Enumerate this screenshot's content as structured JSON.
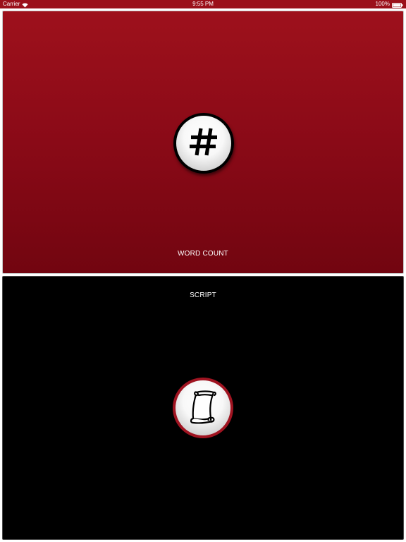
{
  "status_bar": {
    "carrier": "Carrier",
    "time": "9:55 PM",
    "battery": "100%",
    "background_color": "#9b101a"
  },
  "panels": [
    {
      "label": "WORD COUNT",
      "icon": "hash-icon",
      "background_color": "#8a0a17",
      "ring_color": "#000000"
    },
    {
      "label": "SCRIPT",
      "icon": "scroll-icon",
      "background_color": "#000000",
      "ring_color": "#a01421"
    }
  ]
}
